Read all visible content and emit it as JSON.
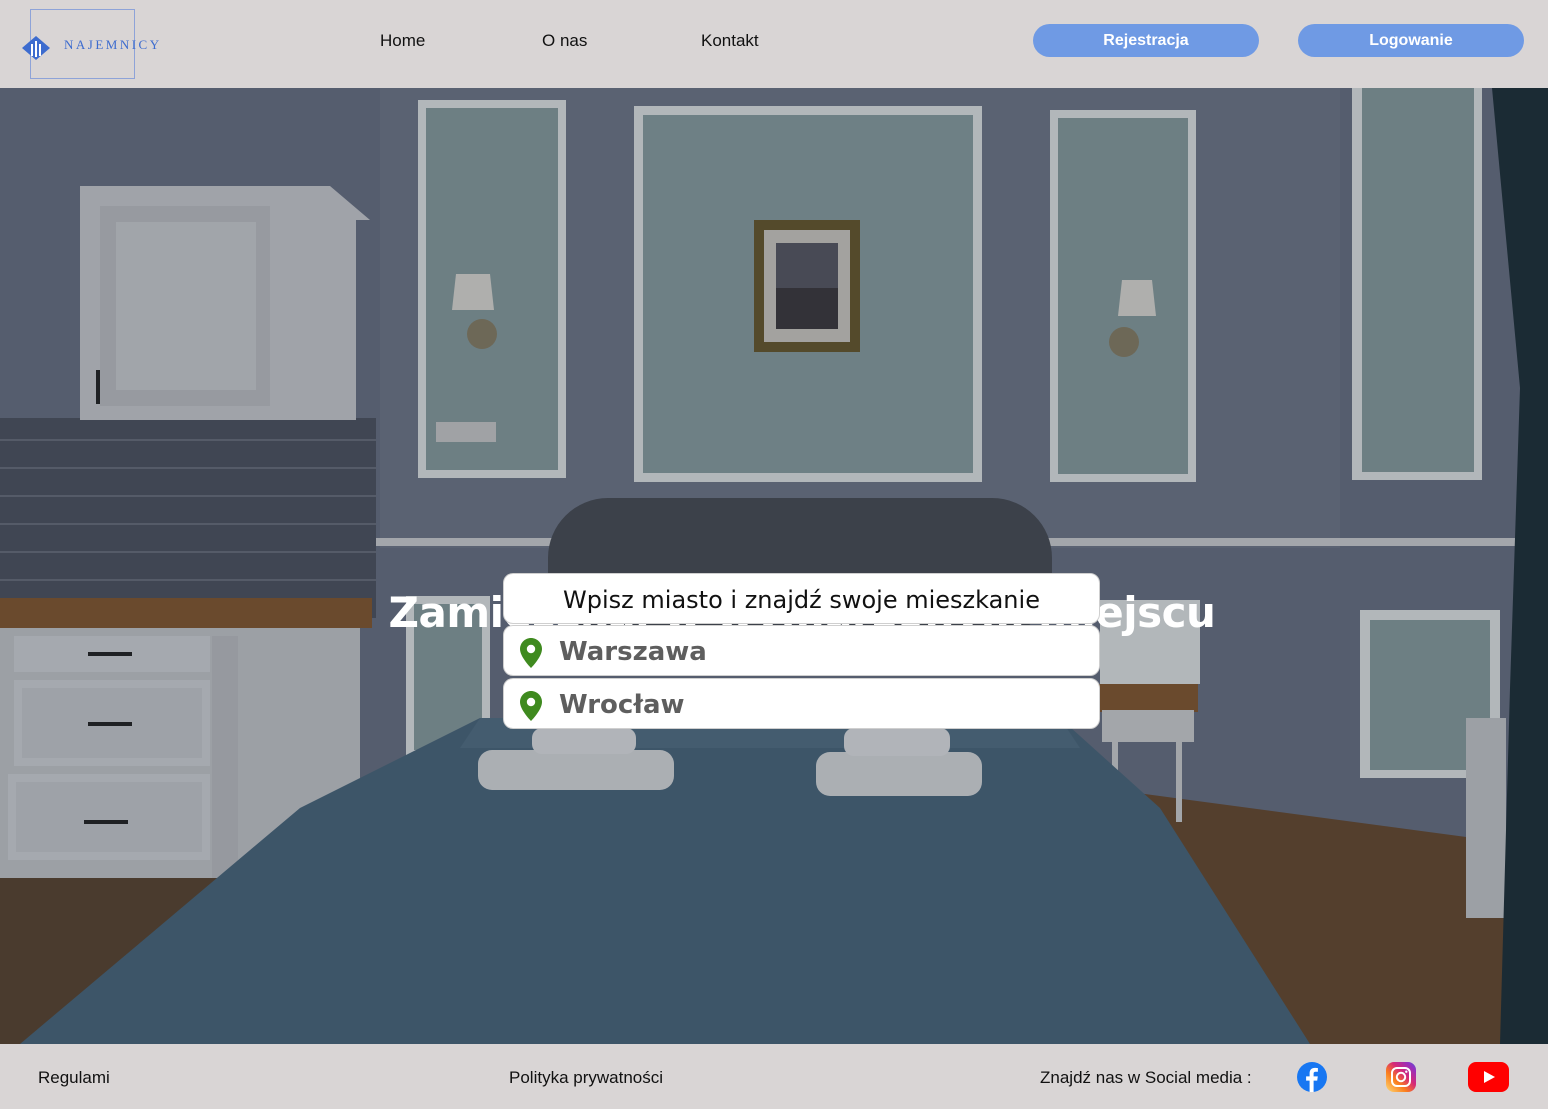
{
  "header": {
    "logo_text": "NAJEMNICY",
    "nav": [
      "Home",
      "O nas",
      "Kontakt"
    ],
    "register_label": "Rejestracja",
    "login_label": "Logowanie"
  },
  "hero": {
    "title": "Zamieszkaj w wymarzonym miejscu",
    "search_prompt": "Wpisz miasto i znajdź swoje mieszkanie",
    "cities": [
      "Warszawa",
      "Wrocław"
    ]
  },
  "footer": {
    "terms": "Regulami",
    "privacy": "Polityka prywatności",
    "social_label": "Znajdź nas w Social media :",
    "social_icons": [
      "facebook-icon",
      "instagram-icon",
      "youtube-icon"
    ]
  },
  "colors": {
    "accent": "#6f9ae4",
    "header_bg": "#d9d5d5",
    "pin": "#3f8a1f",
    "logo": "#3d6ccf"
  }
}
